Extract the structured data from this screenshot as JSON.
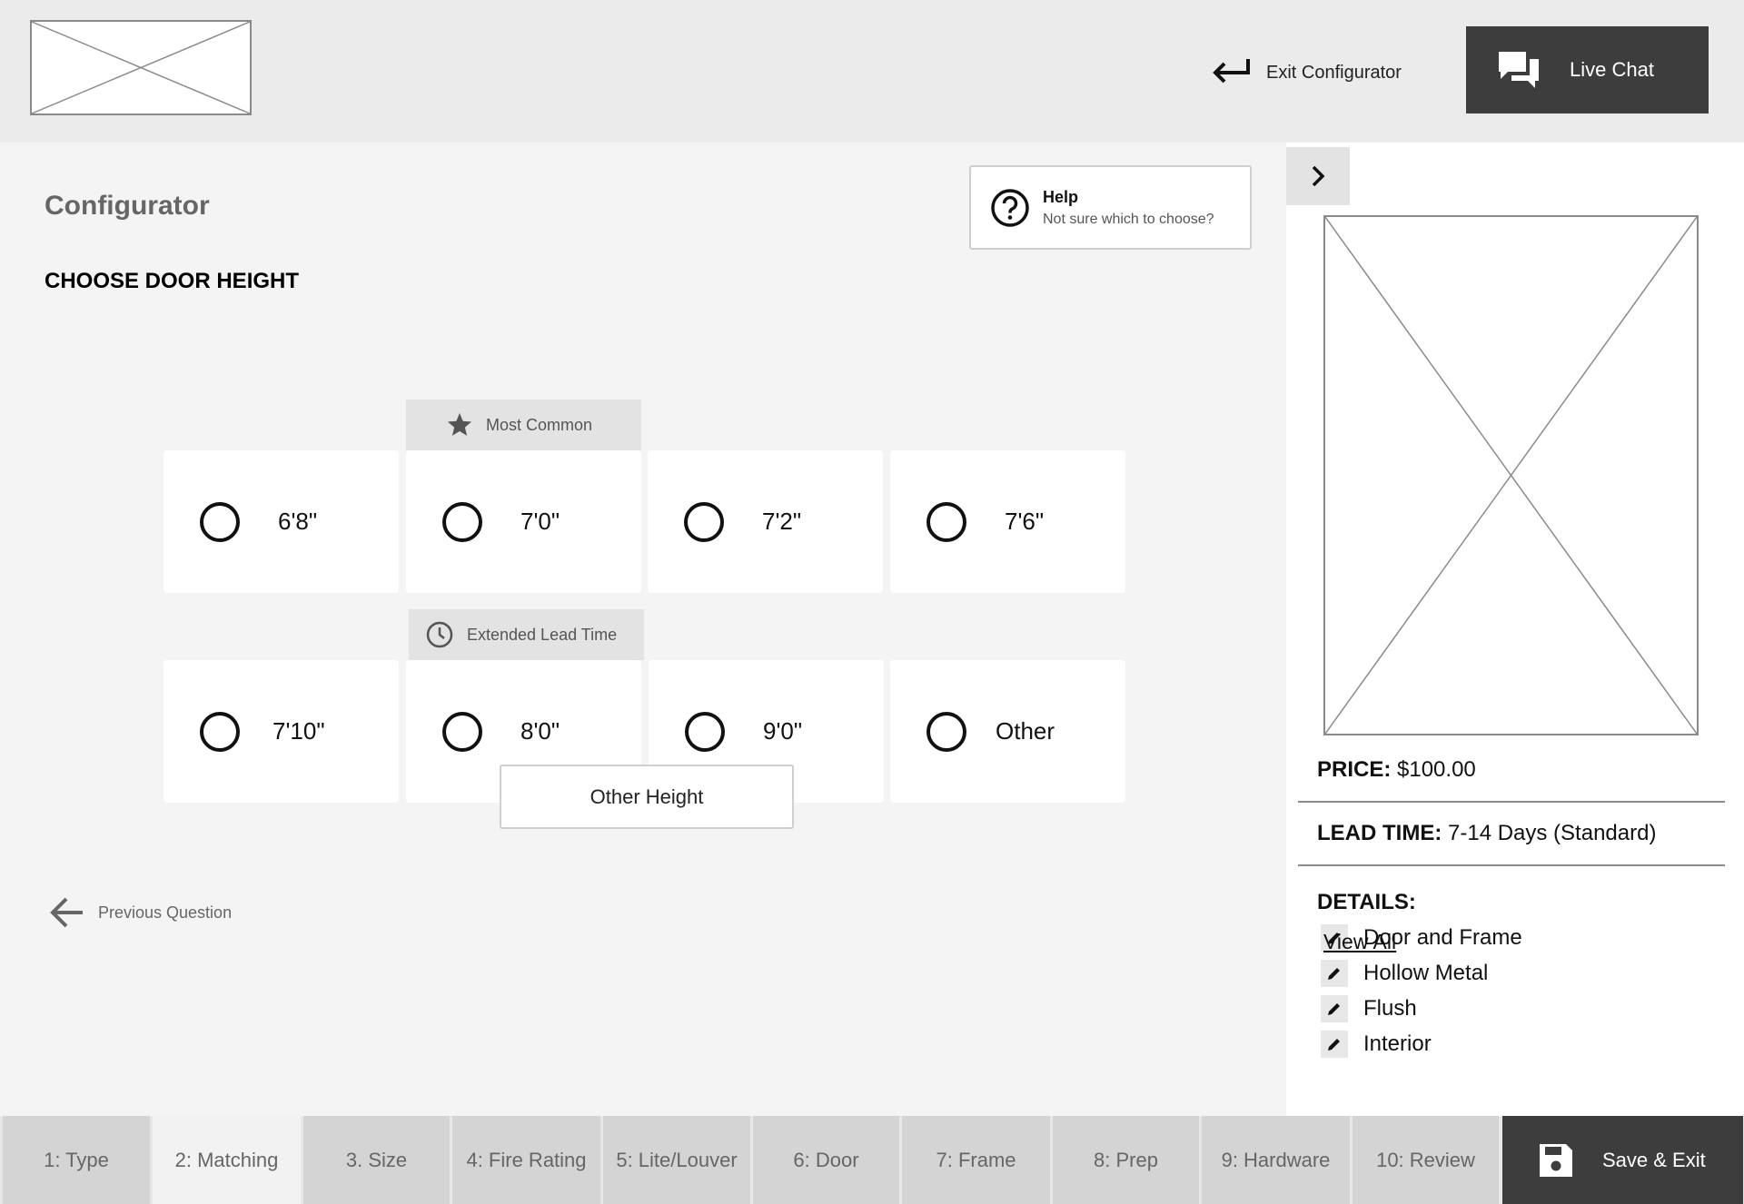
{
  "header": {
    "exit_label": "Exit Configurator",
    "chat_label": "Live Chat"
  },
  "main": {
    "title": "Configurator",
    "subtitle": "CHOOSE DOOR HEIGHT",
    "help": {
      "title": "Help",
      "subtitle": "Not sure which to choose?"
    },
    "tags": {
      "most_common": "Most Common",
      "extended_lead": "Extended Lead Time"
    },
    "options": [
      "6'8\"",
      "7'0\"",
      "7'2\"",
      "7'6\"",
      "7'10\"",
      "8'0\"",
      "9'0\"",
      "Other"
    ],
    "other_height_button": "Other Height",
    "previous_label": "Previous Question"
  },
  "sidebar": {
    "price_label": "PRICE:",
    "price_value": "$100.00",
    "lead_label": "LEAD TIME:",
    "lead_value": "7-14 Days (Standard)",
    "details_label": "DETAILS:",
    "details": [
      "Door and Frame",
      "Hollow Metal",
      "Flush",
      "Interior"
    ],
    "view_all": "View All"
  },
  "steps": [
    "1: Type",
    "2: Matching",
    "3. Size",
    "4: Fire Rating",
    "5: Lite/Louver",
    "6: Door",
    "7: Frame",
    "8: Prep",
    "9: Hardware",
    "10: Review"
  ],
  "active_step": "2: Matching",
  "save_label": "Save & Exit",
  "icons": {
    "exit": "return-arrow-icon",
    "chat": "chat-bubbles-icon",
    "help": "question-circle-icon",
    "most_common": "star-icon",
    "extended_lead": "clock-icon",
    "previous": "arrow-left-icon",
    "collapse": "chevron-right-icon",
    "detail_edit": "pencil-icon",
    "save": "floppy-disk-icon"
  },
  "colors": {
    "dark_button": "#3d3d3d",
    "header_bg": "#ebebeb",
    "main_bg": "#f4f4f4"
  }
}
